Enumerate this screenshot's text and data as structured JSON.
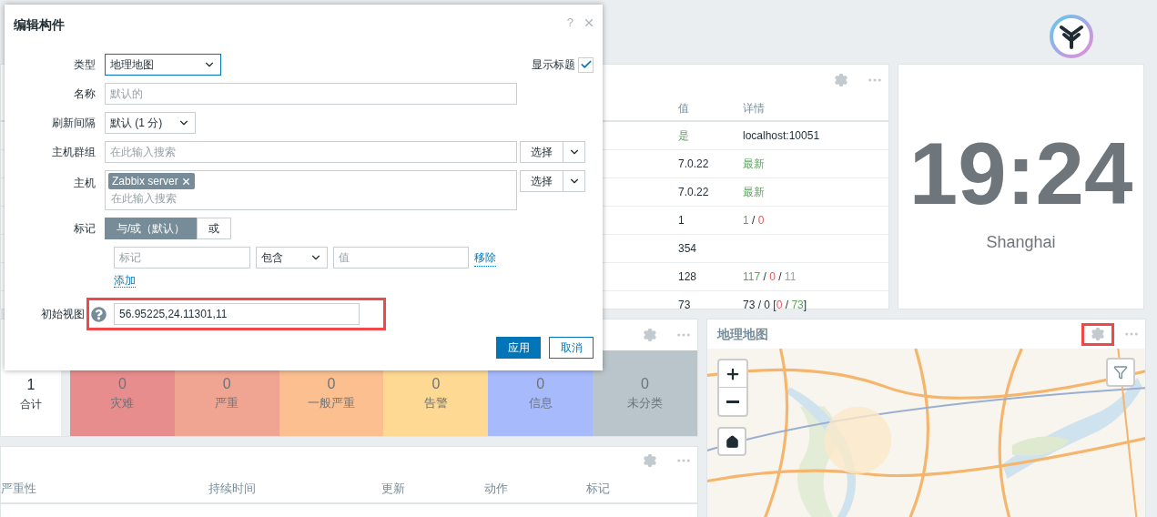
{
  "status_table": {
    "columns": [
      "值",
      "详情"
    ],
    "rows": [
      {
        "value": [
          {
            "text": "是",
            "kind": "ok"
          }
        ],
        "details": [
          {
            "text": "localhost:10051",
            "kind": "plain"
          }
        ]
      },
      {
        "value": [
          {
            "text": "7.0.22",
            "kind": "plain"
          }
        ],
        "details": [
          {
            "text": "最新",
            "kind": "ok"
          }
        ]
      },
      {
        "value": [
          {
            "text": "7.0.22",
            "kind": "plain"
          }
        ],
        "details": [
          {
            "text": "最新",
            "kind": "ok"
          }
        ]
      },
      {
        "value": [
          {
            "text": "1",
            "kind": "plain"
          }
        ],
        "details": [
          {
            "text": "1",
            "kind": "ok"
          },
          {
            "text": " / ",
            "kind": "plain"
          },
          {
            "text": "0",
            "kind": "problem"
          }
        ]
      },
      {
        "value": [
          {
            "text": "354",
            "kind": "plain"
          }
        ],
        "details": []
      },
      {
        "value": [
          {
            "text": "128",
            "kind": "plain"
          }
        ],
        "details": [
          {
            "text": "117",
            "kind": "ok"
          },
          {
            "text": " / ",
            "kind": "plain"
          },
          {
            "text": "0",
            "kind": "problem"
          },
          {
            "text": " / ",
            "kind": "plain"
          },
          {
            "text": "11",
            "kind": "muted"
          }
        ]
      },
      {
        "value": [
          {
            "text": "73",
            "kind": "plain"
          }
        ],
        "details": [
          {
            "text": "73 / 0 [",
            "kind": "plain"
          },
          {
            "text": "0",
            "kind": "problem"
          },
          {
            "text": " / ",
            "kind": "plain"
          },
          {
            "text": "73",
            "kind": "ok"
          },
          {
            "text": "]",
            "kind": "plain"
          }
        ]
      }
    ]
  },
  "clock": {
    "time": "19:24",
    "city": "Shanghai"
  },
  "severity": {
    "total": {
      "count": "1",
      "label": "合计"
    },
    "levels": [
      {
        "count": "0",
        "label": "灾难",
        "color": "#e88d8d"
      },
      {
        "count": "0",
        "label": "严重",
        "color": "#efa592"
      },
      {
        "count": "0",
        "label": "一般严重",
        "color": "#fcbf90"
      },
      {
        "count": "0",
        "label": "告警",
        "color": "#fed993"
      },
      {
        "count": "0",
        "label": "信息",
        "color": "#a6bafc"
      },
      {
        "count": "0",
        "label": "未分类",
        "color": "#b9c5ca"
      }
    ]
  },
  "problems": {
    "columns": [
      "严重性",
      "持续时间",
      "更新",
      "动作",
      "标记"
    ]
  },
  "map": {
    "title": "地理地图",
    "gear_highlighted": true
  },
  "dialog": {
    "title": "编辑构件",
    "help": "?",
    "type": {
      "label": "类型",
      "value": "地理地图"
    },
    "show_header": {
      "label": "显示标题",
      "checked": true
    },
    "name": {
      "label": "名称",
      "placeholder": "默认的"
    },
    "refresh": {
      "label": "刷新间隔",
      "value": "默认 (1 分)"
    },
    "host_groups": {
      "label": "主机群组",
      "placeholder": "在此输入搜索",
      "select": "选择"
    },
    "hosts": {
      "label": "主机",
      "chips": [
        "Zabbix server"
      ],
      "placeholder": "在此输入搜索",
      "select": "选择"
    },
    "tags": {
      "label": "标记",
      "modes": [
        {
          "label": "与/或（默认）",
          "selected": true
        },
        {
          "label": "或",
          "selected": false
        }
      ],
      "rows": [
        {
          "tag_placeholder": "标记",
          "operator": "包含",
          "value_placeholder": "值",
          "remove": "移除"
        }
      ],
      "add": "添加"
    },
    "initial_view": {
      "label": "初始视图",
      "value": "56.95225,24.11301,11",
      "highlighted": true
    },
    "buttons": [
      {
        "label": "应用",
        "kind": "primary"
      },
      {
        "label": "取消",
        "kind": "secondary"
      }
    ]
  }
}
